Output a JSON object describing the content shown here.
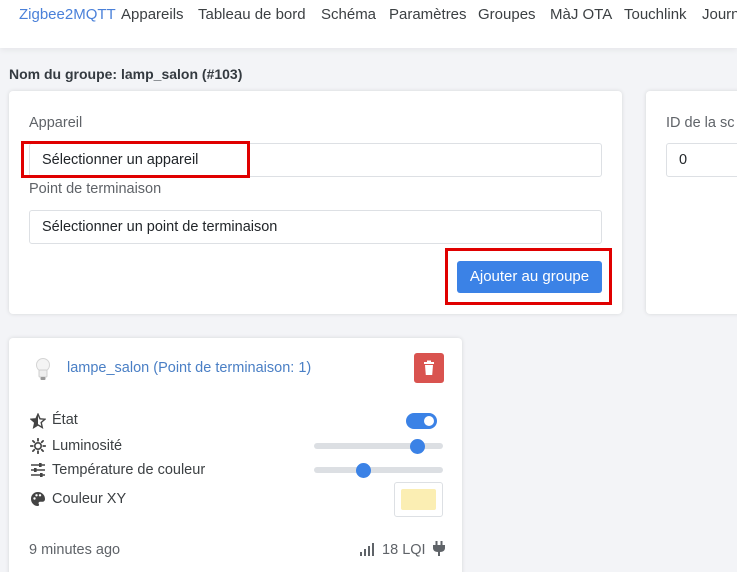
{
  "navbar": {
    "brand": "Zigbee2MQTT",
    "items": [
      "Appareils",
      "Tableau de bord",
      "Schéma",
      "Paramètres",
      "Groupes",
      "MàJ OTA",
      "Touchlink",
      "Journ"
    ]
  },
  "group": {
    "title": "Nom du groupe: lamp_salon (#103)"
  },
  "add_form": {
    "device_label": "Appareil",
    "device_select": "Sélectionner un appareil",
    "endpoint_label": "Point de terminaison",
    "endpoint_select": "Sélectionner un point de terminaison",
    "add_button": "Ajouter au groupe"
  },
  "scene_panel": {
    "id_label": "ID de la sc",
    "id_value": "0"
  },
  "member": {
    "name": "lampe_salon (Point de terminaison: 1)",
    "features": [
      {
        "label": "État",
        "icon": "star-half-icon",
        "control": "toggle",
        "value": true
      },
      {
        "label": "Luminosité",
        "icon": "sun-icon",
        "control": "slider",
        "value": 0.8
      },
      {
        "label": "Température de couleur",
        "icon": "sliders-icon",
        "control": "slider",
        "value": 0.38
      },
      {
        "label": "Couleur XY",
        "icon": "palette-icon",
        "control": "color",
        "value": "#fbeeb3"
      }
    ],
    "last_seen": "9 minutes ago",
    "lqi": "18 LQI"
  },
  "colors": {
    "accent": "#3b82e6",
    "brand": "#4a80d9",
    "danger": "#d9534f",
    "highlight": "#e00000"
  }
}
